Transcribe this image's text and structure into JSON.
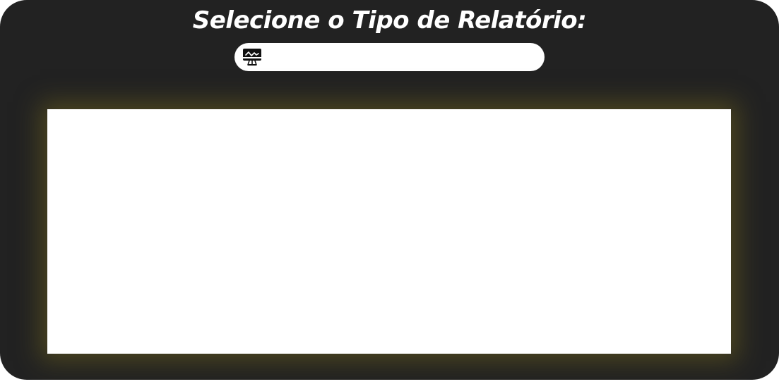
{
  "header": {
    "title": "Selecione o Tipo de Relatório:"
  },
  "report_selector": {
    "icon": "monitor-chart-icon",
    "selected_value": ""
  },
  "colors": {
    "background": "#222222",
    "panel_text": "#ffffff",
    "select_background": "#ffffff",
    "report_area": "#ffffff",
    "report_glow": "#6e621e"
  }
}
